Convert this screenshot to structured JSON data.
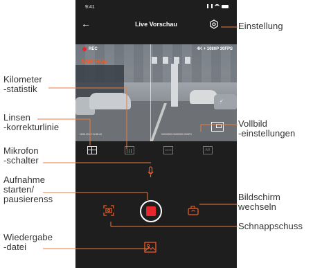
{
  "status_bar": {
    "time": "9:41"
  },
  "nav": {
    "title": "Live Vorschau",
    "back_icon": "arrow-left-icon",
    "settings_icon": "gear-icon"
  },
  "video": {
    "rec_label": "REC",
    "resolution": "4K + 1080P 30FPS",
    "brand": "VANTRUE",
    "timestamp_left": "18/01/2022 11:58:43",
    "timestamp_right": "00000000 00000000 00NFX"
  },
  "tools": {
    "grid": "grid-icon",
    "kilometer": "bar-chart-icon",
    "wdr_label": "WDR",
    "ar_label": "AR"
  },
  "controls": {
    "mic": "microphone-icon",
    "record": "record-icon",
    "snapshot": "snapshot-icon",
    "switch_screen": "switch-camera-icon",
    "playback": "image-icon"
  },
  "callouts": {
    "einstellung": "Einstellung",
    "kilometer_1": "Kilometer",
    "kilometer_2": "-statistik",
    "linsen_1": "Linsen",
    "linsen_2": "-korrekturlinie",
    "mikrofon_1": "Mikrofon",
    "mikrofon_2": "-schalter",
    "aufnahme_1": "Aufnahme",
    "aufnahme_2": "starten/",
    "aufnahme_3": "pausierenss",
    "wiedergabe_1": "Wiedergabe",
    "wiedergabe_2": "-datei",
    "vollbild_1": "Vollbild",
    "vollbild_2": "-einstellungen",
    "bildschirm_1": "Bildschirm",
    "bildschirm_2": "wechseln",
    "schnapp": "Schnappschuss"
  },
  "colors": {
    "accent": "#ef5b24",
    "record": "#e8262e",
    "screen_bg": "#1e1e1e",
    "line": "#ef7a3c"
  }
}
